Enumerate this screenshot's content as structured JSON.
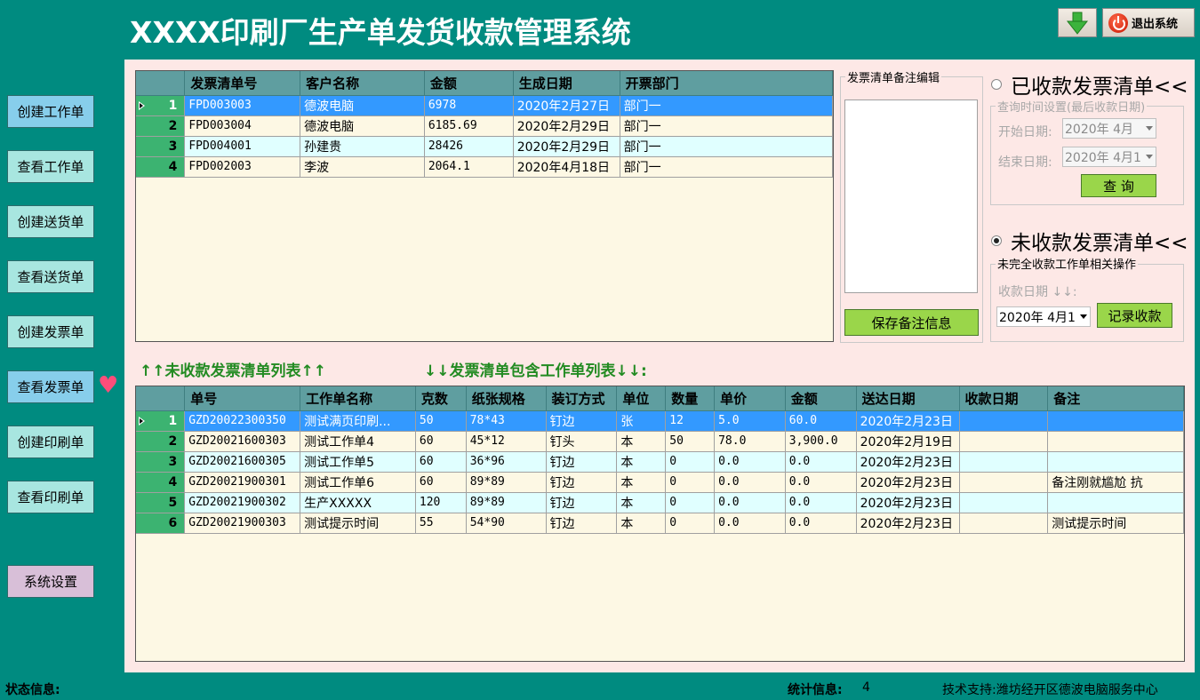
{
  "app": {
    "title": "XXXX印刷厂生产单发货收款管理系统",
    "exit_label": "退出系统"
  },
  "nav": [
    {
      "label": "创建工作单"
    },
    {
      "label": "查看工作单"
    },
    {
      "label": "创建送货单"
    },
    {
      "label": "查看送货单"
    },
    {
      "label": "创建发票单"
    },
    {
      "label": "查看发票单"
    },
    {
      "label": "创建印刷单"
    },
    {
      "label": "查看印刷单"
    },
    {
      "label": "系统设置"
    }
  ],
  "invoice_grid": {
    "columns": [
      "发票清单号",
      "客户名称",
      "金额",
      "生成日期",
      "开票部门"
    ],
    "rows": [
      {
        "idx": "1",
        "no": "FPD003003",
        "customer": "德波电脑",
        "amount": "6978",
        "date": "2020年2月27日",
        "dept": "部门一"
      },
      {
        "idx": "2",
        "no": "FPD003004",
        "customer": "德波电脑",
        "amount": "6185.69",
        "date": "2020年2月29日",
        "dept": "部门一"
      },
      {
        "idx": "3",
        "no": "FPD004001",
        "customer": "孙建贵",
        "amount": "28426",
        "date": "2020年2月29日",
        "dept": "部门一"
      },
      {
        "idx": "4",
        "no": "FPD002003",
        "customer": "李波",
        "amount": "2064.1",
        "date": "2020年4月18日",
        "dept": "部门一"
      }
    ]
  },
  "memo": {
    "legend": "发票清单备注编辑",
    "save_label": "保存备注信息"
  },
  "paid": {
    "label": "已收款发票清单<<",
    "query_legend": "查询时间设置(最后收款日期)",
    "start_label": "开始日期:",
    "start_value": "2020年 4月",
    "end_label": "结束日期:",
    "end_value": "2020年 4月1",
    "query_label": "查 询"
  },
  "unpaid": {
    "label": "未收款发票清单<<",
    "ops_legend": "未完全收款工作单相关操作",
    "date_label": "收款日期 ↓↓:",
    "date_value": "2020年 4月1",
    "record_label": "记录收款"
  },
  "labels": {
    "unpaid_list": "↑↑未收款发票清单列表↑↑",
    "included_list": "↓↓发票清单包含工作单列表↓↓:"
  },
  "work_grid": {
    "columns": [
      "单号",
      "工作单名称",
      "克数",
      "纸张规格",
      "装订方式",
      "单位",
      "数量",
      "单价",
      "金额",
      "送达日期",
      "收款日期",
      "备注"
    ],
    "rows": [
      {
        "idx": "1",
        "no": "GZD20022300350",
        "name": "测试满页印刷...",
        "weight": "50",
        "paper": "78*43",
        "binding": "钉边",
        "unit": "张",
        "qty": "12",
        "price": "5.0",
        "amount": "60.0",
        "delivered": "2020年2月23日",
        "paid": "",
        "note": ""
      },
      {
        "idx": "2",
        "no": "GZD20021600303",
        "name": "测试工作单4",
        "weight": "60",
        "paper": "45*12",
        "binding": "钉头",
        "unit": "本",
        "qty": "50",
        "price": "78.0",
        "amount": "3,900.0",
        "delivered": "2020年2月19日",
        "paid": "",
        "note": ""
      },
      {
        "idx": "3",
        "no": "GZD20021600305",
        "name": "测试工作单5",
        "weight": "60",
        "paper": "36*96",
        "binding": "钉边",
        "unit": "本",
        "qty": "0",
        "price": "0.0",
        "amount": "0.0",
        "delivered": "2020年2月23日",
        "paid": "",
        "note": ""
      },
      {
        "idx": "4",
        "no": "GZD20021900301",
        "name": "测试工作单6",
        "weight": "60",
        "paper": "89*89",
        "binding": "钉边",
        "unit": "本",
        "qty": "0",
        "price": "0.0",
        "amount": "0.0",
        "delivered": "2020年2月23日",
        "paid": "",
        "note": "备注刚就尴尬 抗"
      },
      {
        "idx": "5",
        "no": "GZD20021900302",
        "name": "生产XXXXX",
        "weight": "120",
        "paper": "89*89",
        "binding": "钉边",
        "unit": "本",
        "qty": "0",
        "price": "0.0",
        "amount": "0.0",
        "delivered": "2020年2月23日",
        "paid": "",
        "note": ""
      },
      {
        "idx": "6",
        "no": "GZD20021900303",
        "name": "测试提示时间",
        "weight": "55",
        "paper": "54*90",
        "binding": "钉边",
        "unit": "本",
        "qty": "0",
        "price": "0.0",
        "amount": "0.0",
        "delivered": "2020年2月23日",
        "paid": "",
        "note": "测试提示时间"
      }
    ]
  },
  "status": {
    "status_label": "状态信息:",
    "stats_label": "统计信息:",
    "stats_value": "4",
    "support": "技术支持:潍坊经开区德波电脑服务中心"
  },
  "colors": {
    "background": "#008b80",
    "main_panel": "#fde8e6",
    "grid_header": "#5f9ea0",
    "row_selected": "#3399ff",
    "row_index": "#3cb371",
    "accent_green": "#228b22"
  }
}
